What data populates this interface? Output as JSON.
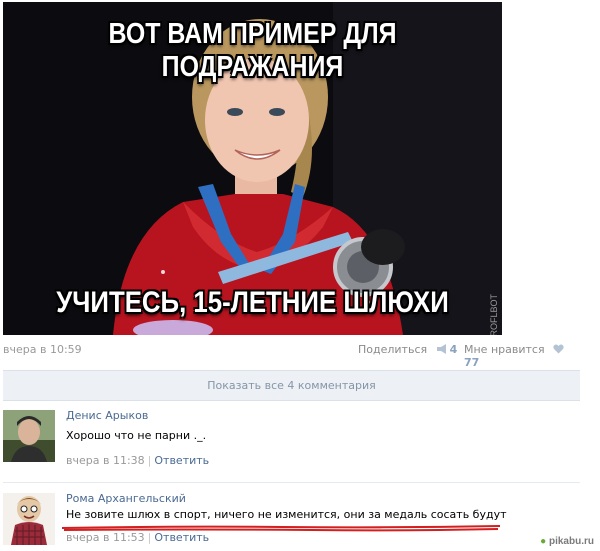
{
  "meme": {
    "top_text": "ВОТ ВАМ ПРИМЕР ДЛЯ ПОДРАЖАНИЯ",
    "bottom_text": "УЧИТЕСЬ, 15-ЛЕТНИЕ ШЛЮХИ",
    "side_watermark": "ROFLBOT"
  },
  "post": {
    "time": "вчера в 10:59",
    "share_label": "Поделиться",
    "share_count": "4",
    "like_label": "Мне нравится",
    "like_count": "77"
  },
  "show_all_comments": "Показать все 4 комментария",
  "comments": [
    {
      "author": "Денис Арыков",
      "text": "Хорошо что не парни ._.",
      "time": "вчера в 11:38",
      "reply_label": "Ответить",
      "separator": "|"
    },
    {
      "author": "Рома Архангельский",
      "text": "Не зовите шлюх в спорт, ничего не изменится, они за медаль сосать будут",
      "time": "вчера в 11:53",
      "reply_label": "Ответить",
      "separator": "|"
    }
  ],
  "footer_watermark": "pikabu.ru",
  "colors": {
    "link": "#4a6a93",
    "meta": "#999999",
    "show_all_bg": "#edf0f4",
    "underline": "#d21f1f"
  }
}
